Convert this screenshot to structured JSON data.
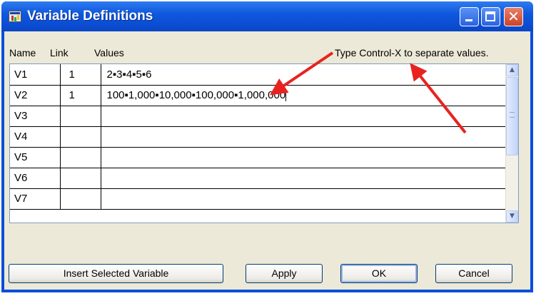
{
  "window": {
    "title": "Variable Definitions",
    "title_bar_color": "#0a4fd8",
    "controls": {
      "minimize": "minimize-icon",
      "maximize": "maximize-icon",
      "close_glyph": "✕"
    }
  },
  "headers": {
    "name": "Name",
    "link": "Link",
    "values": "Values"
  },
  "hint": "Type Control-X to separate values.",
  "rows": [
    {
      "name": "V1",
      "link": "1",
      "values": "2▪3▪4▪5▪6"
    },
    {
      "name": "V2",
      "link": "1",
      "values": "100▪1,000▪10,000▪100,000▪1,000,000"
    },
    {
      "name": "V3",
      "link": "",
      "values": ""
    },
    {
      "name": "V4",
      "link": "",
      "values": ""
    },
    {
      "name": "V5",
      "link": "",
      "values": ""
    },
    {
      "name": "V6",
      "link": "",
      "values": ""
    },
    {
      "name": "V7",
      "link": "",
      "values": ""
    }
  ],
  "scrollbar": {
    "up_glyph": "▲",
    "down_glyph": "▼"
  },
  "buttons": {
    "insert": "Insert Selected Variable",
    "apply": "Apply",
    "ok": "OK",
    "cancel": "Cancel"
  },
  "annotation_color": "#e8231f"
}
